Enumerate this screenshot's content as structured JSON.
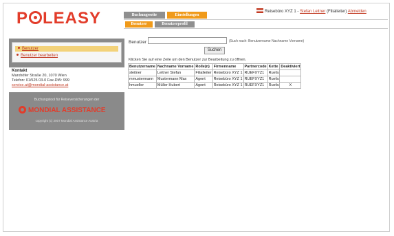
{
  "logo": {
    "prefix": "P",
    "suffix": "LEASY"
  },
  "top_tabs": [
    {
      "label": "Buchungsseite"
    },
    {
      "label": "Einstellungen"
    }
  ],
  "sub_tabs": [
    {
      "label": "Benutzer"
    },
    {
      "label": "Benutzerprofil"
    }
  ],
  "userbar": {
    "agency": "Reisebüro XYZ 1 -",
    "user": "Stefan Leitner",
    "role": "(Filialleiter)",
    "logout": "Abmelden"
  },
  "sidebar": {
    "items": [
      {
        "label": "Benutzer",
        "active": true
      },
      {
        "label": "Benutzer bearbeiten",
        "active": false
      }
    ],
    "contact": {
      "title": "Kontakt",
      "address": "Marxhöfer Straße 20, 1070 Wien",
      "phone": "Telefon: 01/525 03-0 Fax-DW: 999",
      "email": "service.at@mondial-assistance.at"
    },
    "note": "Buchungstool für Reiseversicherungen der",
    "brand": "MONDIAL ASSISTANCE",
    "copyright": "copyright (c) 2007 Mondial Assistance Austria"
  },
  "search": {
    "label": "Benutzer",
    "value": "",
    "hint": "(Such nach: Benutzername Nachname Vorname)",
    "button": "Suchen"
  },
  "instruction": "Klicken Sie auf eine Zeile um den Benutzer zur Bearbeitung zu öffnen.",
  "table": {
    "headers": [
      "Benutzername",
      "Nachname Vorname",
      "Rolle(n)",
      "Firmenname",
      "Partnercode",
      "Kette",
      "Deaktiviert"
    ],
    "rows": [
      [
        "sleitner",
        "Leitner Stefan",
        "Filialleiter",
        "Reisebüro XYZ 1",
        "RUEFXYZ1",
        "Ruefa",
        ""
      ],
      [
        "mmustermann",
        "Mustermann Max",
        "Agent",
        "Reisebüro XYZ 1",
        "RUEFXYZ1",
        "Ruefa",
        ""
      ],
      [
        "hmueller",
        "Müller Hubert",
        "Agent",
        "Reisebüro XYZ 1",
        "RUEFXYZ1",
        "Ruefa",
        "X"
      ]
    ]
  },
  "colors": {
    "brand_red": "#e23c2a",
    "tab_orange": "#f09a1a",
    "tab_gray": "#8f8f8f",
    "sidebar_gray": "#8a8a8a"
  }
}
